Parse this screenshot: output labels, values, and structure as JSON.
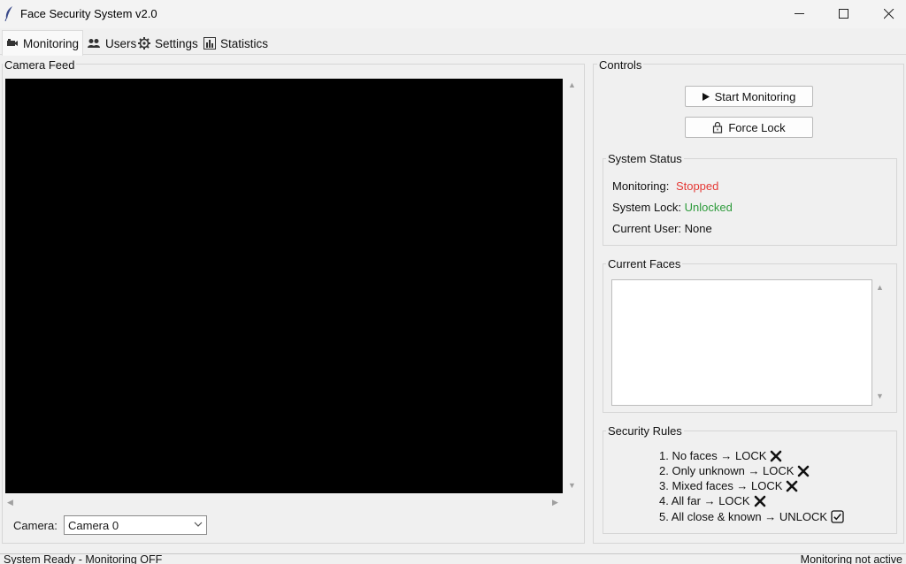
{
  "window": {
    "title": "Face Security System v2.0",
    "minimize_icon": "minimize-icon",
    "maximize_icon": "maximize-icon",
    "close_icon": "close-icon"
  },
  "tabs": [
    {
      "label": "Monitoring",
      "icon": "camera-icon",
      "active": true
    },
    {
      "label": "Users",
      "icon": "users-icon",
      "active": false
    },
    {
      "label": "Settings",
      "icon": "gear-icon",
      "active": false
    },
    {
      "label": "Statistics",
      "icon": "bar-chart-icon",
      "active": false
    }
  ],
  "camera_feed": {
    "label": "Camera Feed",
    "camera_label": "Camera:",
    "camera_value": "Camera 0"
  },
  "controls": {
    "label": "Controls",
    "start_button": "Start Monitoring",
    "force_lock_button": "Force Lock"
  },
  "system_status": {
    "label": "System Status",
    "monitoring_label": "Monitoring:",
    "monitoring_value": "Stopped",
    "lock_label": "System Lock:",
    "lock_value": "Unlocked",
    "user_label": "Current User:",
    "user_value": "None",
    "colors": {
      "stopped": "#e53935",
      "unlocked": "#2e9b3c"
    }
  },
  "current_faces": {
    "label": "Current Faces",
    "items": []
  },
  "security_rules": {
    "label": "Security Rules",
    "rules": [
      {
        "text": "1. No faces → LOCK",
        "icon": "cross-icon"
      },
      {
        "text": "2. Only unknown → LOCK",
        "icon": "cross-icon"
      },
      {
        "text": "3. Mixed faces → LOCK",
        "icon": "cross-icon"
      },
      {
        "text": "4. All far → LOCK",
        "icon": "cross-icon"
      },
      {
        "text": "5. All close & known → UNLOCK",
        "icon": "check-box-icon"
      }
    ]
  },
  "statusbar": {
    "left": "System Ready - Monitoring OFF",
    "right": "Monitoring not active"
  }
}
